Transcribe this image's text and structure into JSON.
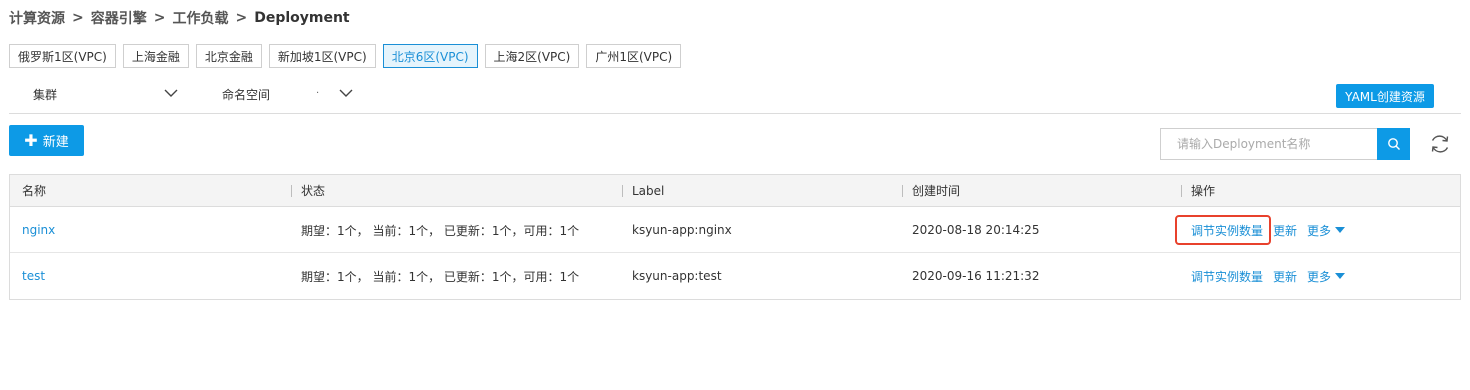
{
  "breadcrumb": {
    "items": [
      "计算资源",
      "容器引擎",
      "工作负载"
    ],
    "separator": ">",
    "current": "Deployment"
  },
  "regions": {
    "items": [
      "俄罗斯1区(VPC)",
      "上海金融",
      "北京金融",
      "新加坡1区(VPC)",
      "北京6区(VPC)",
      "上海2区(VPC)",
      "广州1区(VPC)"
    ],
    "active": "北京6区(VPC)"
  },
  "filters": {
    "cluster_label": "集群",
    "namespace_label": "命名空间",
    "namespace_value": "·"
  },
  "toolbar": {
    "yaml_button": "YAML创建资源",
    "new_button": "新建",
    "new_icon": "plus-icon",
    "search_placeholder": "请输入Deployment名称",
    "search_icon": "search-icon",
    "refresh_icon": "refresh-icon"
  },
  "table": {
    "columns": [
      "名称",
      "状态",
      "Label",
      "创建时间",
      "操作"
    ],
    "rows": [
      {
        "name": "nginx",
        "status": "期望：1个， 当前：1个， 已更新：1个，可用：1个",
        "label": "ksyun-app:nginx",
        "created": "2020-08-18 20:14:25",
        "action_scale": "调节实例数量",
        "action_update": "更新",
        "action_more": "更多"
      },
      {
        "name": "test",
        "status": "期望：1个， 当前：1个， 已更新：1个，可用：1个",
        "label": "ksyun-app:test",
        "created": "2020-09-16 11:21:32",
        "action_scale": "调节实例数量",
        "action_update": "更新",
        "action_more": "更多"
      }
    ]
  },
  "colors": {
    "primary": "#0d9ae6",
    "link": "#1a8fd6",
    "highlight": "#e8412c",
    "header_bg": "#f4f4f4"
  }
}
